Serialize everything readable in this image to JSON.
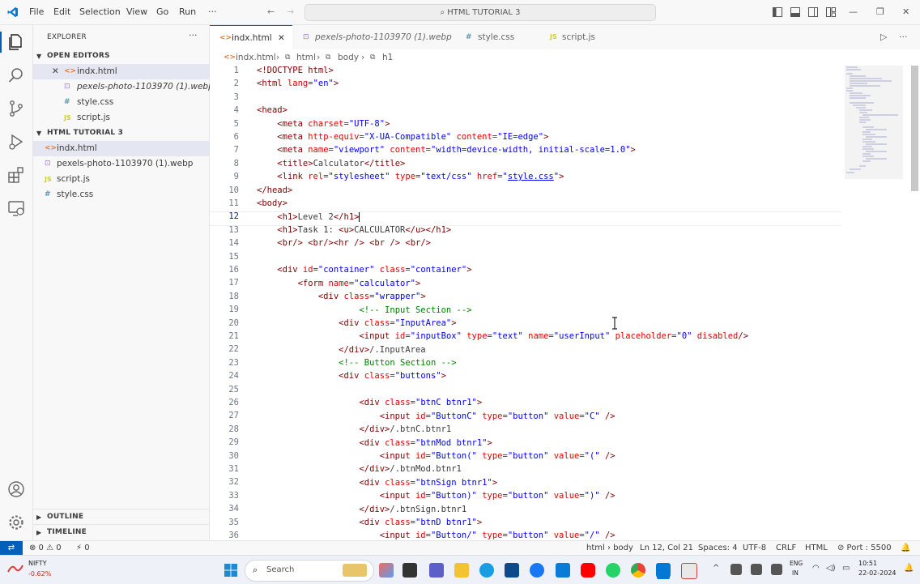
{
  "titlebar": {
    "menu": [
      "File",
      "Edit",
      "Selection",
      "View",
      "Go",
      "Run",
      "···"
    ],
    "search_text": "HTML TUTORIAL 3",
    "window_controls": [
      "—",
      "❐",
      "✕"
    ]
  },
  "activitybar": {
    "icons": [
      "explorer-icon",
      "search-icon",
      "source-control-icon",
      "run-debug-icon",
      "extensions-icon",
      "remote-explorer-icon",
      "account-icon",
      "settings-gear-icon"
    ]
  },
  "sidebar": {
    "title": "EXPLORER",
    "more": "···",
    "open_editors_label": "OPEN EDITORS",
    "open_editors": [
      {
        "name": "indx.html",
        "type": "html",
        "close": "✕"
      },
      {
        "name": "pexels-photo-1103970 (1).webp",
        "type": "img"
      },
      {
        "name": "style.css",
        "type": "css"
      },
      {
        "name": "script.js",
        "type": "js"
      }
    ],
    "folder_label": "HTML TUTORIAL 3",
    "files": [
      {
        "name": "indx.html",
        "type": "html"
      },
      {
        "name": "pexels-photo-1103970 (1).webp",
        "type": "img"
      },
      {
        "name": "script.js",
        "type": "js"
      },
      {
        "name": "style.css",
        "type": "css"
      }
    ],
    "outline_label": "OUTLINE",
    "timeline_label": "TIMELINE"
  },
  "tabs": [
    {
      "label": "indx.html",
      "icon": "<>",
      "close": "✕",
      "active": true
    },
    {
      "label": "pexels-photo-1103970 (1).webp",
      "icon": "⊡",
      "active": false
    },
    {
      "label": "style.css",
      "icon": "#",
      "active": false
    },
    {
      "label": "script.js",
      "icon": "JS",
      "active": false
    }
  ],
  "breadcrumb": [
    "indx.html",
    "html",
    "body",
    "h1"
  ],
  "editor": {
    "current_line": "12",
    "line_numbers": [
      "1",
      "2",
      "3",
      "4",
      "5",
      "6",
      "7",
      "8",
      "9",
      "10",
      "11",
      "12",
      "13",
      "14",
      "15",
      "16",
      "17",
      "18",
      "19",
      "20",
      "21",
      "22",
      "23",
      "24",
      "25",
      "26",
      "27",
      "28",
      "29",
      "30",
      "31",
      "32",
      "33",
      "34",
      "35",
      "36"
    ]
  },
  "statusbar": {
    "remote": "⇄",
    "problems": "⊗ 0 ⚠ 0",
    "ports": "⚡ 0",
    "language_path": "html › body",
    "position": "Ln 12, Col 21",
    "spaces": "Spaces: 4",
    "encoding": "UTF-8",
    "eol": "CRLF",
    "language": "HTML",
    "port": "⊘ Port : 5500",
    "bell": "🔔"
  },
  "taskbar": {
    "stock_name": "NIFTY",
    "stock_change": "-0.62%",
    "search_placeholder": "Search",
    "lang_top": "ENG",
    "lang_bottom": "IN",
    "time": "10:51",
    "date": "22-02-2024"
  }
}
